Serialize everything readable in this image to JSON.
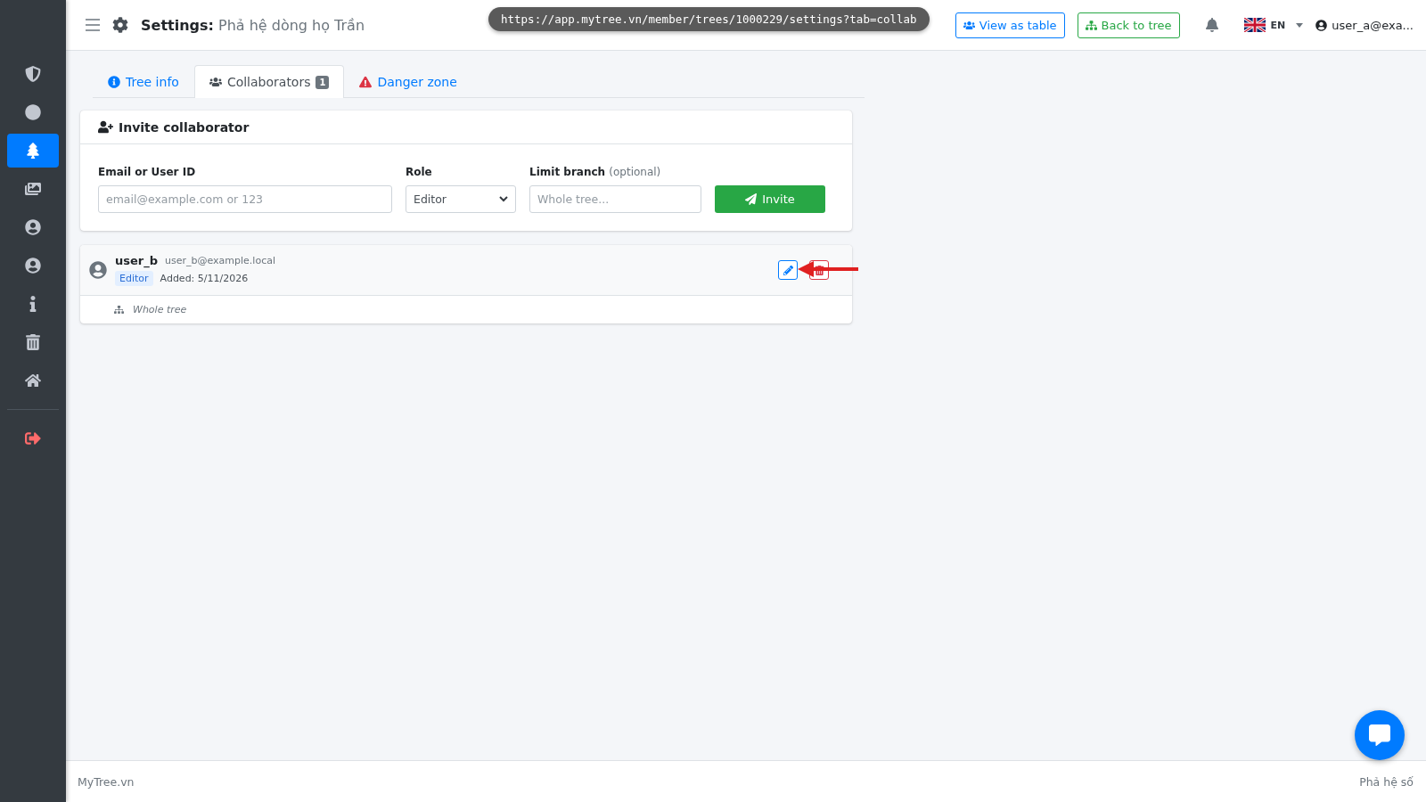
{
  "sidebar": {
    "items": [
      {
        "selected": false
      },
      {
        "selected": false
      },
      {
        "selected": true
      },
      {
        "selected": false
      },
      {
        "selected": false
      },
      {
        "selected": false
      },
      {
        "selected": false
      },
      {
        "selected": false
      },
      {
        "selected": false
      }
    ],
    "logout": {
      "selected": false
    }
  },
  "header": {
    "title_bold": "Settings:",
    "title": "Phả hệ dòng họ Trần",
    "url": "https://app.mytree.vn/member/trees/1000229/settings?tab=collab",
    "view_table": "View as table",
    "back_tree": "Back to tree",
    "language": "EN",
    "user": "user_a@exa..."
  },
  "tabs": [
    {
      "label": "Tree info",
      "kind": "info",
      "selected": false
    },
    {
      "label": "Collaborators",
      "kind": "people",
      "badge": "1",
      "selected": true
    },
    {
      "label": "Danger zone",
      "kind": "danger",
      "selected": false
    }
  ],
  "invite": {
    "title": "Invite collaborator",
    "email_label": "Email or User ID",
    "email_placeholder": "email@example.com or 123",
    "role_label": "Role",
    "role_value": "Editor",
    "branch_label": "Limit branch",
    "branch_hint": "(optional)",
    "branch_placeholder": "Whole tree...",
    "button": "Invite"
  },
  "collaborators": [
    {
      "name": "user_b",
      "email": "user_b@example.local",
      "role": "Editor",
      "added": "Added: 5/11/2026",
      "branch": "Whole tree"
    }
  ],
  "footer": {
    "left": "MyTree.vn",
    "right": "Phả hệ số"
  }
}
